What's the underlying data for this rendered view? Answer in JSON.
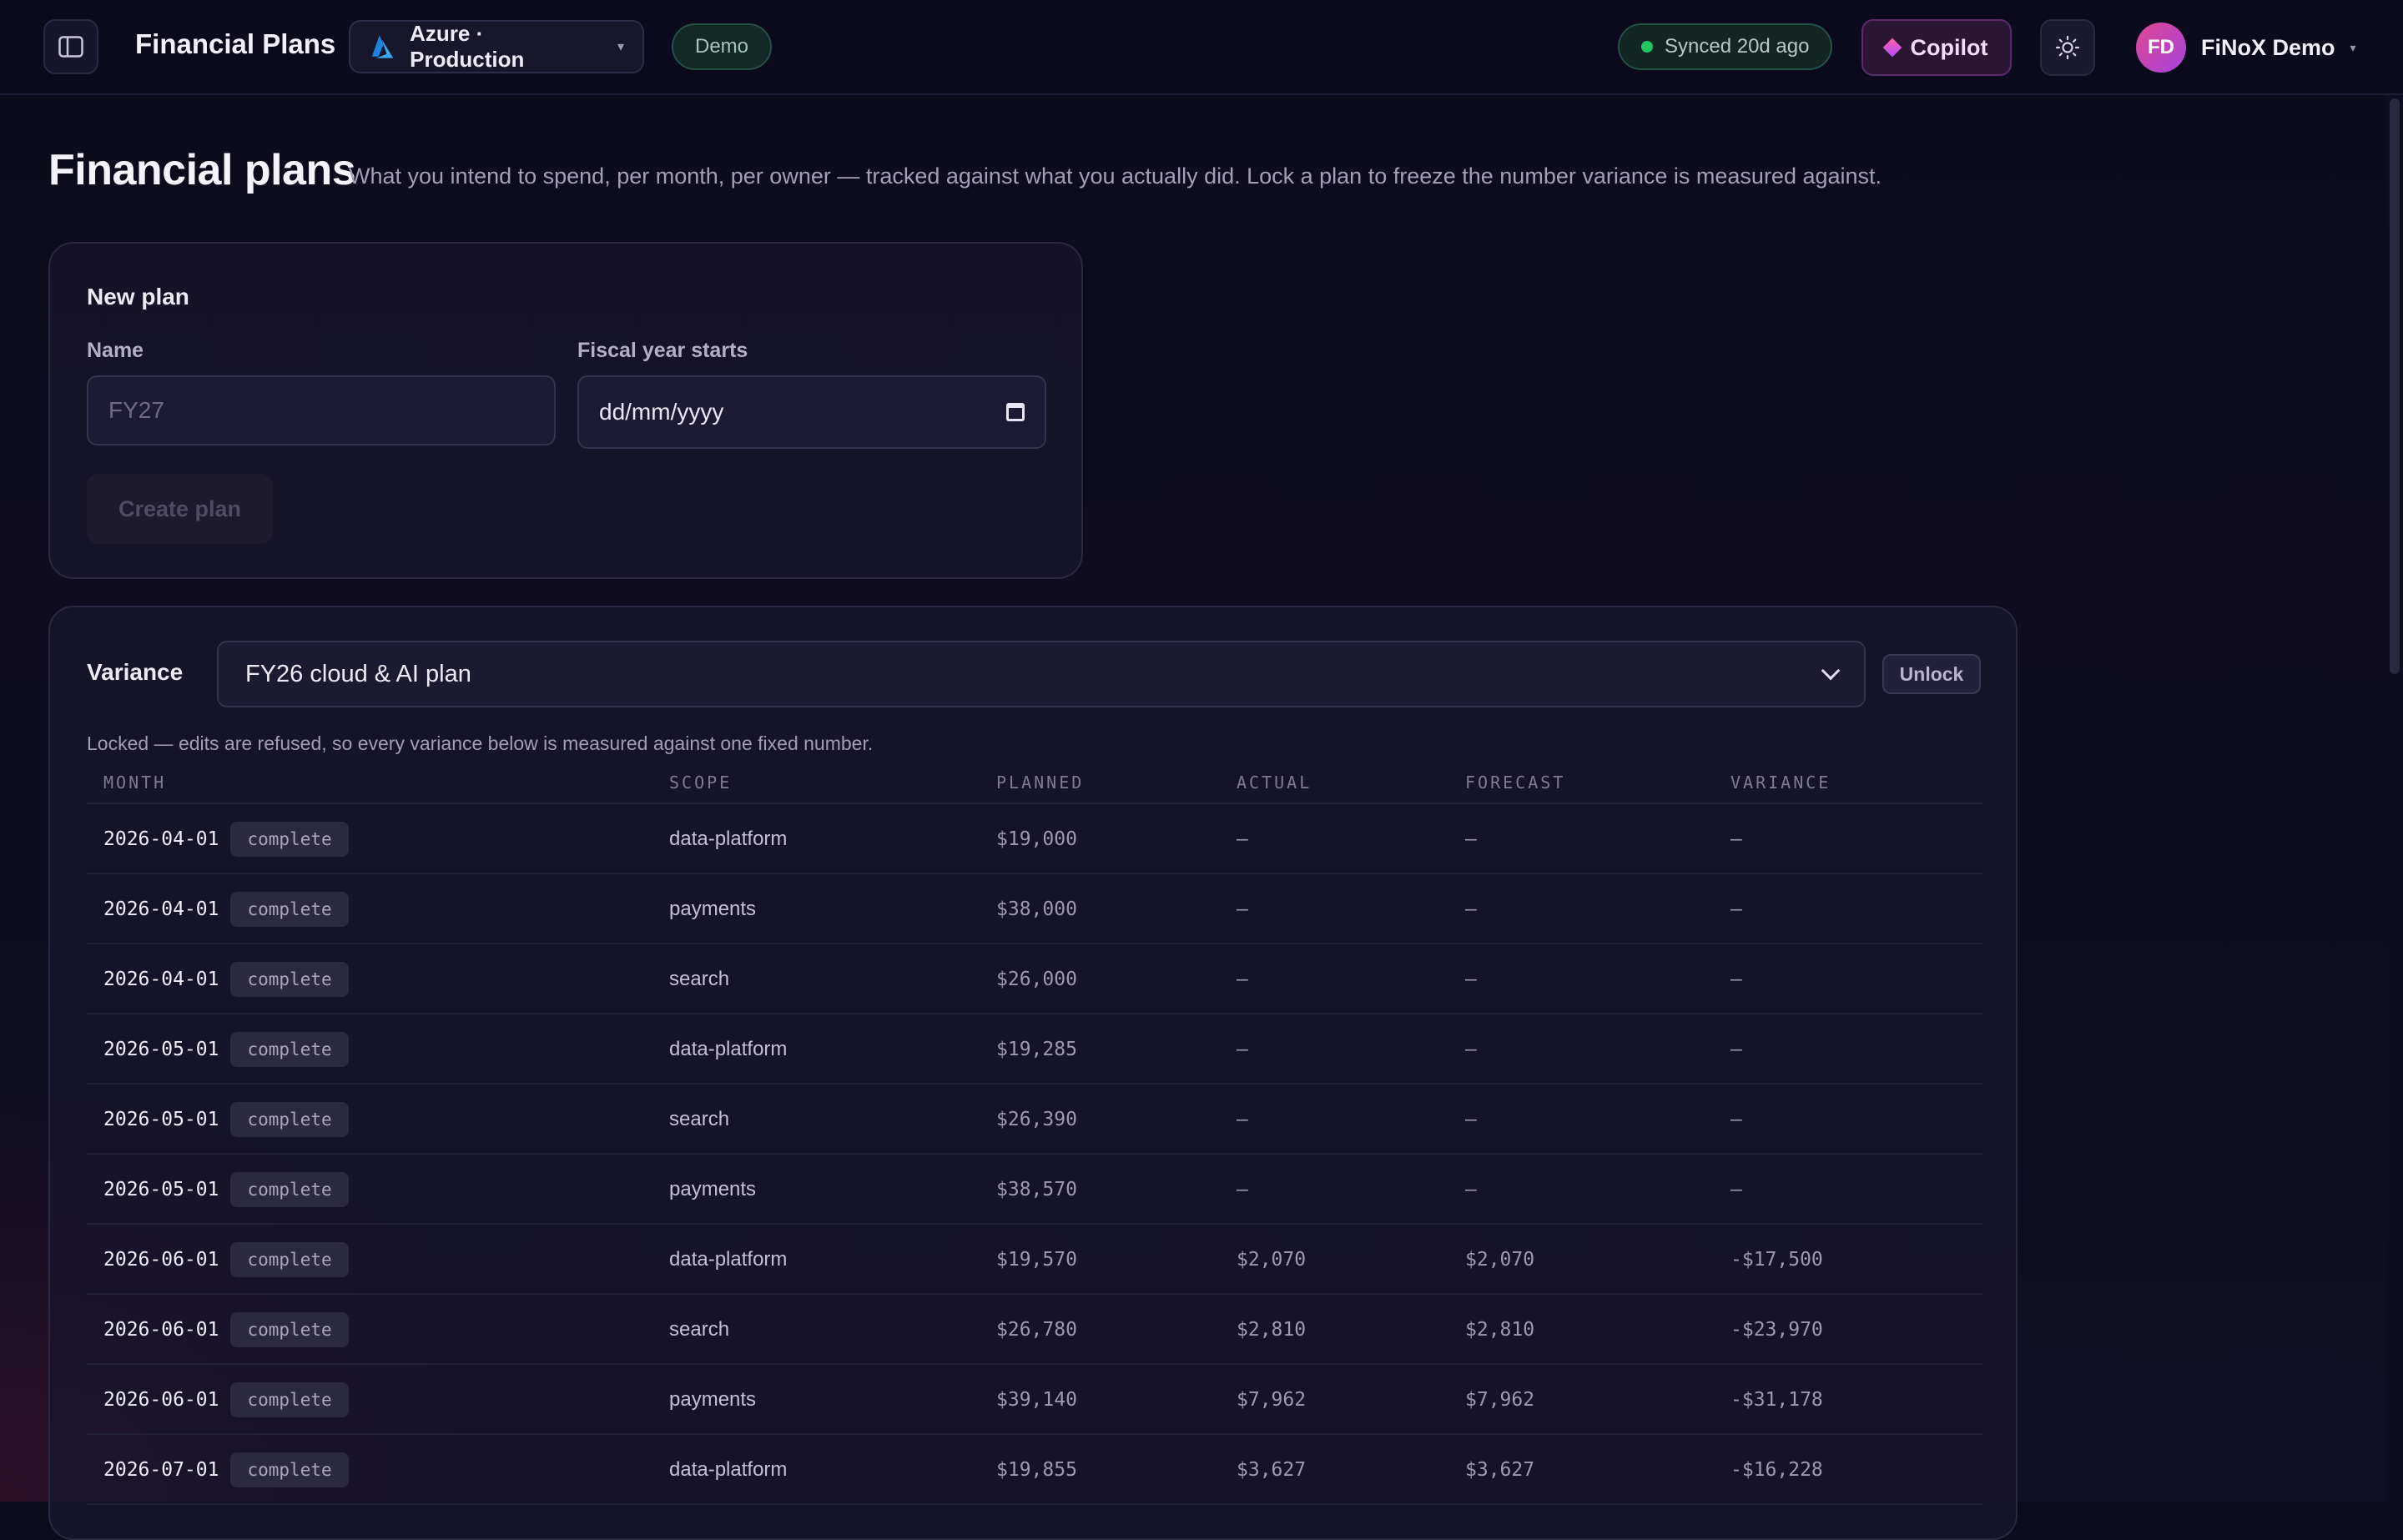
{
  "topbar": {
    "app_title": "Financial Plans",
    "cloud_selector": "Azure · Production",
    "demo_badge": "Demo",
    "sync_status": "Synced 20d ago",
    "copilot_label": "Copilot",
    "user_initials": "FD",
    "user_name": "FiNoX Demo"
  },
  "page": {
    "title": "Financial plans",
    "subtitle": "What you intend to spend, per month, per owner — tracked against what you actually did. Lock a plan to freeze the number variance is measured against."
  },
  "new_plan": {
    "title": "New plan",
    "name_label": "Name",
    "name_placeholder": "FY27",
    "fiscal_label": "Fiscal year starts",
    "fiscal_placeholder": "dd/mm/yyyy",
    "create_label": "Create plan"
  },
  "variance": {
    "label": "Variance",
    "selected_plan": "FY26 cloud & AI plan",
    "unlock_label": "Unlock",
    "locked_note": "Locked — edits are refused, so every variance below is measured against one fixed number.",
    "columns": [
      "MONTH",
      "SCOPE",
      "PLANNED",
      "ACTUAL",
      "FORECAST",
      "VARIANCE"
    ],
    "rows": [
      {
        "month": "2026-04-01",
        "status": "complete",
        "scope": "data-platform",
        "planned": "$19,000",
        "actual": "—",
        "forecast": "—",
        "variance": "—"
      },
      {
        "month": "2026-04-01",
        "status": "complete",
        "scope": "payments",
        "planned": "$38,000",
        "actual": "—",
        "forecast": "—",
        "variance": "—"
      },
      {
        "month": "2026-04-01",
        "status": "complete",
        "scope": "search",
        "planned": "$26,000",
        "actual": "—",
        "forecast": "—",
        "variance": "—"
      },
      {
        "month": "2026-05-01",
        "status": "complete",
        "scope": "data-platform",
        "planned": "$19,285",
        "actual": "—",
        "forecast": "—",
        "variance": "—"
      },
      {
        "month": "2026-05-01",
        "status": "complete",
        "scope": "search",
        "planned": "$26,390",
        "actual": "—",
        "forecast": "—",
        "variance": "—"
      },
      {
        "month": "2026-05-01",
        "status": "complete",
        "scope": "payments",
        "planned": "$38,570",
        "actual": "—",
        "forecast": "—",
        "variance": "—"
      },
      {
        "month": "2026-06-01",
        "status": "complete",
        "scope": "data-platform",
        "planned": "$19,570",
        "actual": "$2,070",
        "forecast": "$2,070",
        "variance": "-$17,500"
      },
      {
        "month": "2026-06-01",
        "status": "complete",
        "scope": "search",
        "planned": "$26,780",
        "actual": "$2,810",
        "forecast": "$2,810",
        "variance": "-$23,970"
      },
      {
        "month": "2026-06-01",
        "status": "complete",
        "scope": "payments",
        "planned": "$39,140",
        "actual": "$7,962",
        "forecast": "$7,962",
        "variance": "-$31,178"
      },
      {
        "month": "2026-07-01",
        "status": "complete",
        "scope": "data-platform",
        "planned": "$19,855",
        "actual": "$3,627",
        "forecast": "$3,627",
        "variance": "-$16,228"
      }
    ]
  },
  "colors": {
    "accent": "#b14cff",
    "sync_dot": "#22c55e",
    "azure_blue": "#0078d4"
  }
}
